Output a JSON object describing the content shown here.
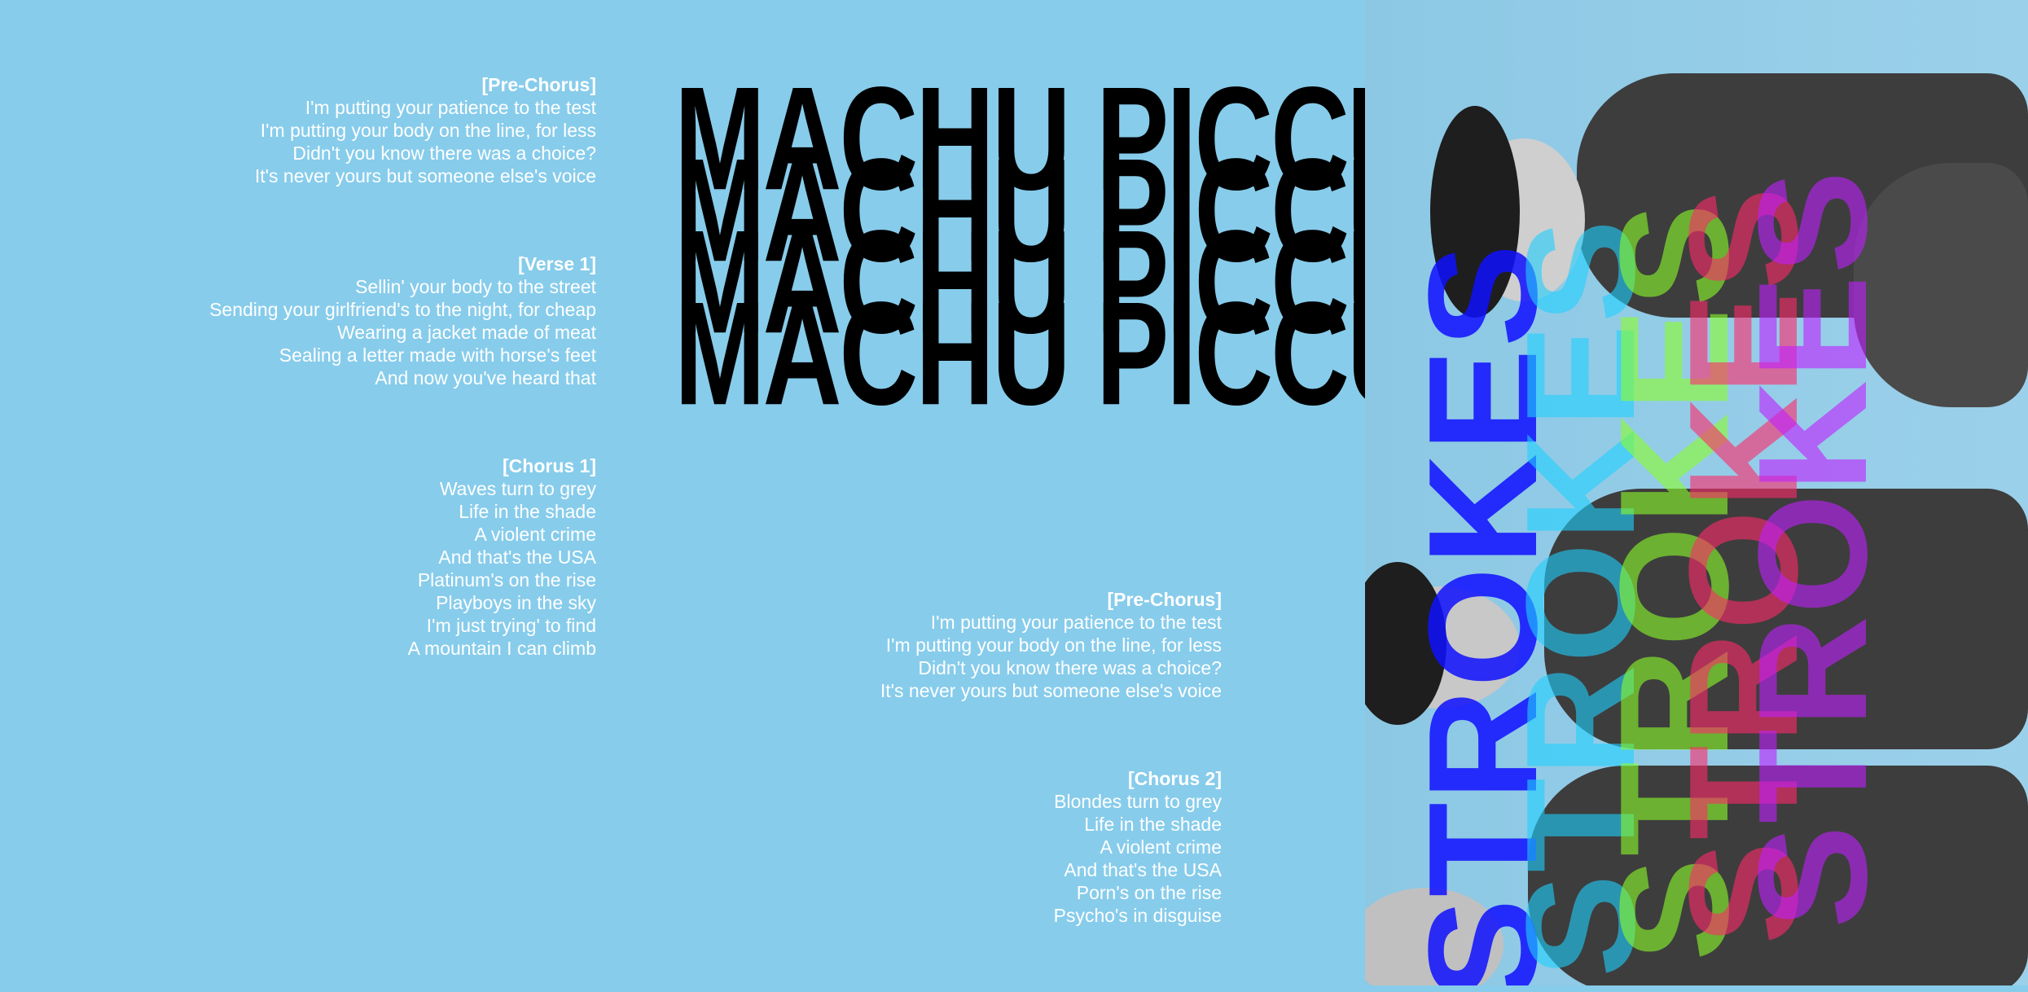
{
  "title_repeats": [
    "MACHU PICCU",
    "MACHU PICCU",
    "MACHU PICCU",
    "MACHU PICCU"
  ],
  "lyrics_left": [
    {
      "header": "[Pre-Chorus]",
      "lines": [
        "I'm putting your patience to the test",
        "I'm putting your body on the line, for less",
        "Didn't you know there was a choice?",
        "It's never yours but someone else's voice"
      ]
    },
    {
      "header": "[Verse 1]",
      "lines": [
        "Sellin' your body to the street",
        "Sending your girlfriend's to the night, for cheap",
        "Wearing a jacket made of meat",
        "Sealing a letter made with horse's feet",
        "And now you've heard that"
      ]
    },
    {
      "header": "[Chorus 1]",
      "lines": [
        "Waves turn to grey",
        "Life in the shade",
        "A violent crime",
        "And that's the USA",
        "Platinum's on the rise",
        "Playboys in the sky",
        "I'm just trying' to find",
        "A mountain I can climb"
      ]
    }
  ],
  "lyrics_mid": [
    {
      "header": "[Pre-Chorus]",
      "lines": [
        "I'm putting your patience to the test",
        "I'm putting your body on the line, for less",
        "Didn't you know there was a choice?",
        "It's never yours but someone else's voice"
      ]
    },
    {
      "header": "[Chorus 2]",
      "lines": [
        "Blondes turn to grey",
        "Life in the shade",
        "A violent crime",
        "And that's the USA",
        "Porn's on the rise",
        "Psycho's in disguise"
      ]
    }
  ],
  "logo_text": "STROKES",
  "logo_colors": [
    "#1010ff",
    "#1fd0ff",
    "#8cff2a",
    "#ff2a6a",
    "#c020ff"
  ],
  "background_color": "#87cceb"
}
